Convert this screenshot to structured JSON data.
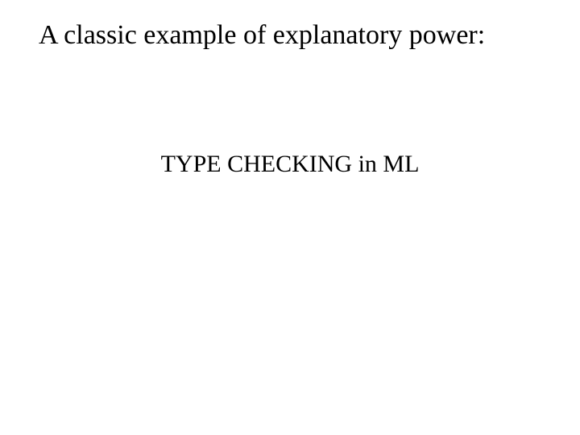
{
  "slide": {
    "heading": "A classic example of explanatory power:",
    "subheading": "TYPE CHECKING in ML"
  }
}
